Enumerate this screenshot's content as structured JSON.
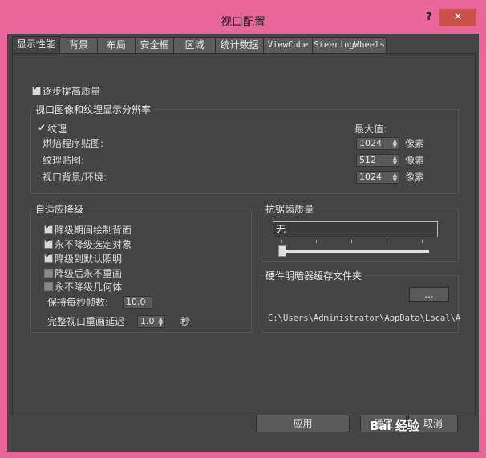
{
  "window": {
    "title": "视口配置",
    "help": "?",
    "close": "✕"
  },
  "tabs": [
    "显示性能",
    "背景",
    "布局",
    "安全框",
    "区域",
    "统计数据",
    "ViewCube",
    "SteeringWheels"
  ],
  "progressive": {
    "label": "逐步提高质量",
    "checked": true
  },
  "resolution": {
    "title": "视口图像和纹理显示分辨率",
    "texture_label": "纹理",
    "texture_checked": true,
    "max_label": "最大值:",
    "rows": [
      {
        "label": "烘焙程序贴图:",
        "value": "1024",
        "unit": "像素"
      },
      {
        "label": "纹理贴图:",
        "value": "512",
        "unit": "像素"
      },
      {
        "label": "视口背景/环境:",
        "value": "1024",
        "unit": "像素"
      }
    ]
  },
  "adaptive": {
    "title": "自适应降级",
    "items": [
      {
        "label": "降级期间绘制背面",
        "checked": true,
        "enabled": true
      },
      {
        "label": "永不降级选定对象",
        "checked": true,
        "enabled": true
      },
      {
        "label": "降级到默认照明",
        "checked": true,
        "enabled": true
      },
      {
        "label": "降级后永不重画",
        "checked": false,
        "enabled": false
      },
      {
        "label": "永不降级几何体",
        "checked": false,
        "enabled": false
      }
    ],
    "fps_label": "保持每秒帧数:",
    "fps_value": "10.0",
    "delay_label": "完整视口重画延迟",
    "delay_value": "1.0",
    "delay_unit": "秒"
  },
  "antialias": {
    "title": "抗锯齿质量",
    "value": "无",
    "slider_position": 0
  },
  "cache": {
    "title": "硬件明暗器缓存文件夹",
    "browse_label": "...",
    "path": "C:\\Users\\Administrator\\AppData\\Local\\A"
  },
  "footer": {
    "apply_label": "应用",
    "ok_label": "确定",
    "cancel_label": "取消"
  },
  "watermark": "Bai 经验"
}
